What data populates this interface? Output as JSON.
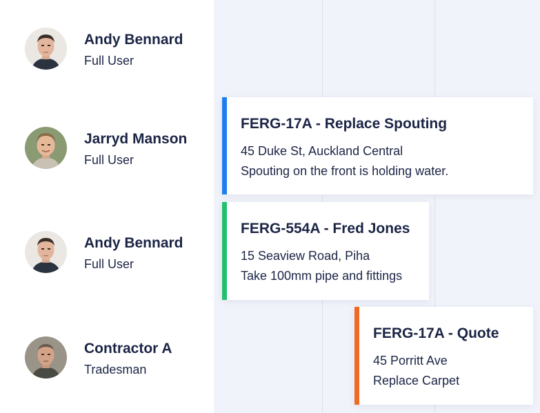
{
  "people": [
    {
      "name": "Andy Bennard",
      "role": "Full User",
      "avatar_icon": "person-avatar"
    },
    {
      "name": "Jarryd Manson",
      "role": "Full User",
      "avatar_icon": "person-avatar"
    },
    {
      "name": "Andy Bennard",
      "role": "Full User",
      "avatar_icon": "person-avatar"
    },
    {
      "name": "Contractor A",
      "role": "Tradesman",
      "avatar_icon": "person-avatar"
    }
  ],
  "jobs": [
    {
      "title": "FERG-17A - Replace Spouting",
      "address": "45 Duke St, Auckland Central",
      "note": "Spouting on the front is holding water.",
      "color": "#1e7ef0"
    },
    {
      "title": "FERG-554A - Fred Jones",
      "address": "15 Seaview Road, Piha",
      "note": "Take 100mm pipe and fittings",
      "color": "#22c06e"
    },
    {
      "title": "FERG-17A - Quote",
      "address": "45 Porritt Ave",
      "note": "Replace Carpet",
      "color": "#f06a23"
    }
  ],
  "colors": {
    "text": "#1b2445",
    "schedule_background": "#f1f3fa",
    "gridline": "#dde1ee"
  }
}
